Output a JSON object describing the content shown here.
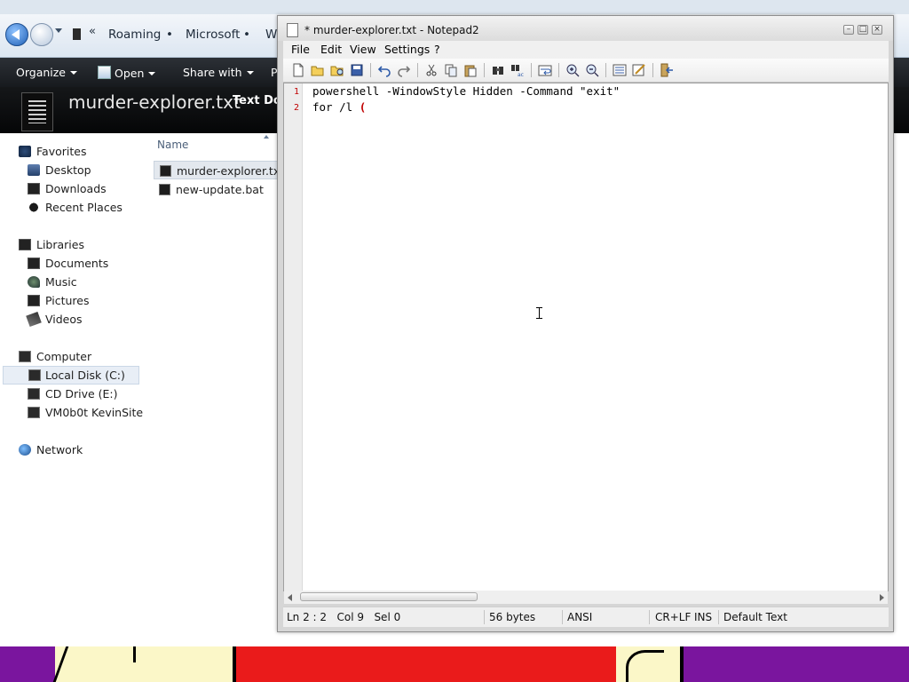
{
  "explorer": {
    "breadcrumb": {
      "overflow": "«",
      "items": [
        "Roaming",
        "Microsoft",
        "W"
      ],
      "separator": "•"
    },
    "toolbar": {
      "organize": "Organize",
      "open": "Open",
      "share_with": "Share with",
      "more": "P"
    },
    "details": {
      "file_name": "murder-explorer.txt",
      "file_type": "Text Do"
    },
    "nav": {
      "favorites": {
        "label": "Favorites",
        "items": [
          "Desktop",
          "Downloads",
          "Recent Places"
        ]
      },
      "libraries": {
        "label": "Libraries",
        "items": [
          "Documents",
          "Music",
          "Pictures",
          "Videos"
        ]
      },
      "computer": {
        "label": "Computer",
        "items": [
          "Local Disk (C:)",
          "CD Drive (E:)",
          "VM0b0t KevinSite"
        ]
      },
      "network": {
        "label": "Network"
      }
    },
    "file_list": {
      "column_name": "Name",
      "files": [
        "murder-explorer.txt",
        "new-update.bat"
      ]
    }
  },
  "notepad": {
    "title": "* murder-explorer.txt - Notepad2",
    "menu": [
      "File",
      "Edit",
      "View",
      "Settings",
      "?"
    ],
    "lines": [
      {
        "number": "1",
        "text": "powershell -WindowStyle Hidden -Command \"exit\""
      },
      {
        "number": "2",
        "text": "for /l ",
        "bracket": "("
      }
    ],
    "status": {
      "position": "Ln 2 : 2   Col 9   Sel 0",
      "bytes": "56 bytes",
      "encoding": "ANSI",
      "eol": "CR+LF",
      "mode": "INS",
      "scheme": "Default Text"
    },
    "toolbar_icons": [
      "new-icon",
      "open-icon",
      "browse-icon",
      "save-icon",
      "undo-icon",
      "redo-icon",
      "cut-icon",
      "copy-icon",
      "paste-icon",
      "find-icon",
      "replace-icon",
      "word-wrap-icon",
      "zoom-in-icon",
      "zoom-out-icon",
      "scheme-icon",
      "customize-scheme-icon",
      "exit-icon"
    ]
  },
  "colors": {
    "accent": "#1f5fb5",
    "explorer_toolbar": "#1c1f23",
    "line_number": "#c00000",
    "wallpaper_purple": "#7a159e",
    "wallpaper_red": "#ea1b1b"
  }
}
